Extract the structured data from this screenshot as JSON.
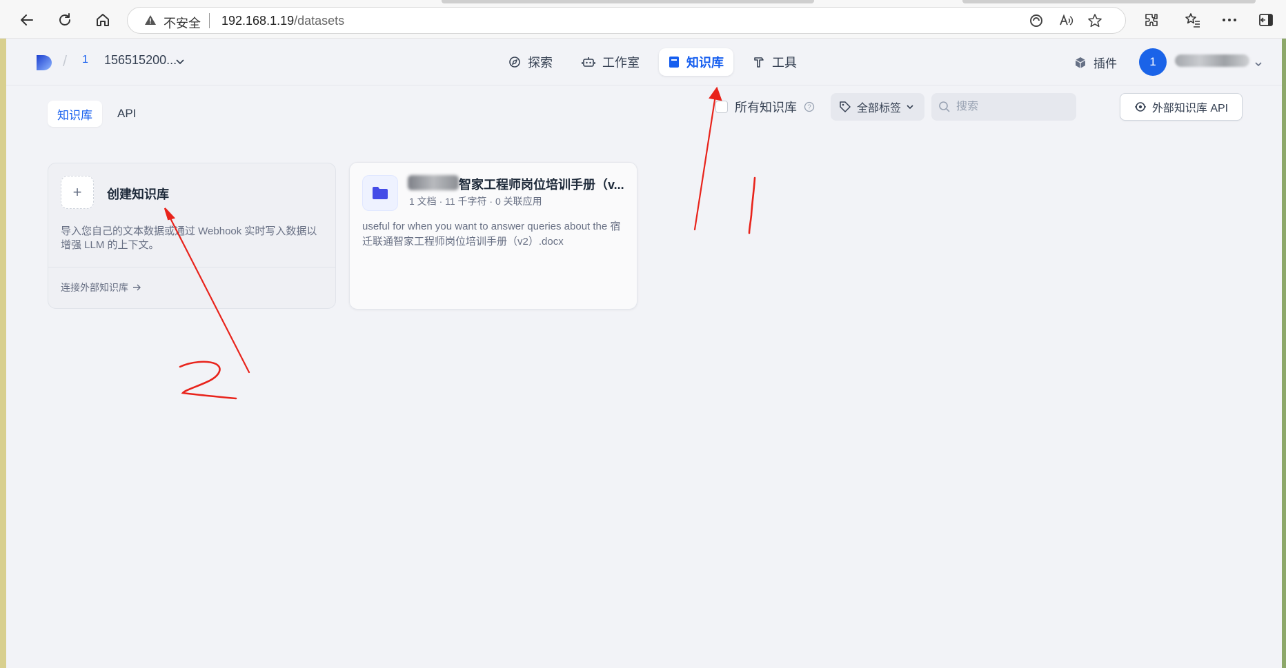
{
  "browser": {
    "insecure_label": "不安全",
    "url_host": "192.168.1.19",
    "url_path": "/datasets"
  },
  "header": {
    "workspace_badge": "1",
    "workspace_name": "156515200...",
    "nav": [
      {
        "label": "探索",
        "icon": "compass-icon",
        "active": false
      },
      {
        "label": "工作室",
        "icon": "robot-icon",
        "active": false
      },
      {
        "label": "知识库",
        "icon": "book-icon",
        "active": true
      },
      {
        "label": "工具",
        "icon": "hammer-icon",
        "active": false
      }
    ],
    "plugin_label": "插件",
    "avatar_initial": "1"
  },
  "subtabs": [
    {
      "label": "知识库",
      "active": true
    },
    {
      "label": "API",
      "active": false
    }
  ],
  "toolbar": {
    "all_kb_label": "所有知识库",
    "tag_filter_label": "全部标签",
    "search_placeholder": "搜索",
    "external_api_label": "外部知识库 API"
  },
  "create_card": {
    "plus": "+",
    "title": "创建知识库",
    "description": "导入您自己的文本数据或通过 Webhook 实时写入数据以增强 LLM 的上下文。",
    "connect_label": "连接外部知识库"
  },
  "dataset_card": {
    "title": "智家工程师岗位培训手册（v...",
    "meta": "1 文档 · 11 千字符 · 0 关联应用",
    "description": "useful for when you want to answer queries about the 宿迁联通智家工程师岗位培训手册（v2）.docx"
  },
  "annotations": {
    "colors": {
      "marker": "#e8231b",
      "accent": "#155eef"
    }
  }
}
